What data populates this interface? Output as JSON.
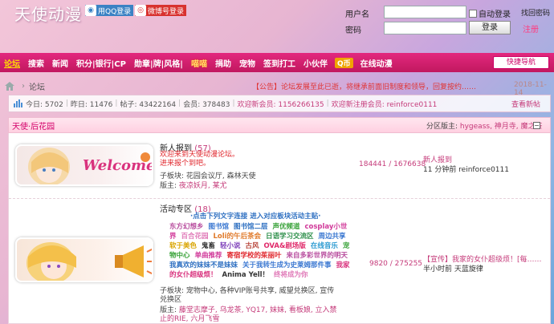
{
  "header": {
    "logo": "天使动漫",
    "qq_login": "用QQ登录",
    "weibo_login": "微博号登录",
    "username_label": "用户名",
    "password_label": "密码",
    "remember_label": "自动登录",
    "find_password": "找回密码",
    "login_button": "登录",
    "register": "注册"
  },
  "nav": {
    "items": [
      {
        "label": "论坛"
      },
      {
        "label": "搜索"
      },
      {
        "label": "新闻"
      },
      {
        "label": "积分|银行|CP"
      },
      {
        "label": "勋章|牌|风格|"
      },
      {
        "label": "喵喵"
      },
      {
        "label": "捐助"
      },
      {
        "label": "宠物"
      },
      {
        "label": "签到打工"
      },
      {
        "label": "小伙伴"
      },
      {
        "label": "Q币"
      },
      {
        "label": "在线动漫"
      }
    ],
    "quick_nav": "快捷导航"
  },
  "breadcrumb": {
    "current": "论坛",
    "notice": "【公告】论坛发展至此已逝，将继承前面旧制度和领导，回复按约……",
    "notice_time": "2018-11-14"
  },
  "stats": {
    "today": "今日: 5702",
    "yesterday": "昨日: 11476",
    "posts": "帖子: 43422164",
    "members": "会员: 378483",
    "welcome_new": "欢迎新会员: 1156266135",
    "welcome_registered": "欢迎新注册会员: reinforce0111",
    "newest_posts": "查看新帖"
  },
  "section": {
    "title": "天使·后花园",
    "mods_label": "分区版主: ",
    "mods": "hygeass, 神月寺, 魔之茶"
  },
  "forums": [
    {
      "title": "新人报到",
      "count": "(57)",
      "desc_line1": "欢迎来到天使动漫论坛。",
      "desc_line2": "进来报个到吧。",
      "subforums": "子板块: 花园会议厅, 森林天使",
      "moderators_label": "版主: ",
      "moderators": "夜凉妖月, 某尤",
      "numbers": "184441 / 1676638",
      "last_title": "新人报到",
      "last_time": "11 分钟前 reinforce0111",
      "thumb_text": "Welcome"
    },
    {
      "title": "活动专区",
      "count": "(18)",
      "line_intro": "·点击下列文字连接 进入对应板块活动主贴·",
      "rainbow": [
        {
          "t": "东方幻想乡",
          "c": "#b84d9e"
        },
        {
          "t": "图书馆",
          "c": "#3a77d1"
        },
        {
          "t": "图书馆二层",
          "c": "#2d6fc1"
        },
        {
          "t": "声优频道",
          "c": "#3aa33a"
        },
        {
          "t": "cosplay小世界",
          "c": "#d13a9a"
        },
        {
          "t": "百合花园",
          "c": "#e07ab8"
        },
        {
          "t": "Loli的午后茶会",
          "c": "#e07a2a"
        },
        {
          "t": "日语学习交流区",
          "c": "#2d8f4a"
        },
        {
          "t": "周边共享",
          "c": "#3a77d1"
        },
        {
          "t": "软于美色",
          "c": "#d9a400"
        },
        {
          "t": "鬼畜",
          "c": "#333333"
        },
        {
          "t": "轻小说",
          "c": "#7a3ab8"
        },
        {
          "t": "古风",
          "c": "#b8453a"
        },
        {
          "t": "OVA&剧场版",
          "c": "#e02a6a"
        },
        {
          "t": "在线音乐",
          "c": "#2a9ad1"
        },
        {
          "t": "宠物中心",
          "c": "#3aa33a"
        },
        {
          "t": "单曲推荐",
          "c": "#d13a9a"
        },
        {
          "t": "寄宿学校的茱丽叶",
          "c": "#e0262c"
        },
        {
          "t": "来自多彩世界的明天",
          "c": "#b84d9e"
        },
        {
          "t": "我真欢的妹妹不是妹妹",
          "c": "#2d6fc1"
        },
        {
          "t": "关于我转生成为史莱姆那件事",
          "c": "#3a77d1"
        },
        {
          "t": "我家的女仆超级烦！",
          "c": "#d9337e"
        },
        {
          "t": "Anima Yell！",
          "c": "#333333"
        },
        {
          "t": "终将成为你",
          "c": "#e07ab8"
        }
      ],
      "subforums": "子板块: 宠物中心, 各种VIP账号共享, 威望兑换区, 宣传兑换区",
      "moderators_label": "版主: ",
      "moderators": "藤堂志摩子, 乌龙茶, YQ17, 妹妹, 看板娘, 立入禁止的RIE, 六月飞雪",
      "numbers": "9820 / 275255",
      "last_title": "【宣传】我家的女仆超级烦！[每……",
      "last_time": "半小时前 天蓝旋律"
    }
  ],
  "colors": {
    "nav_pink": "#d61f73",
    "accent": "#c53b7a",
    "red_text": "#e0262c"
  }
}
